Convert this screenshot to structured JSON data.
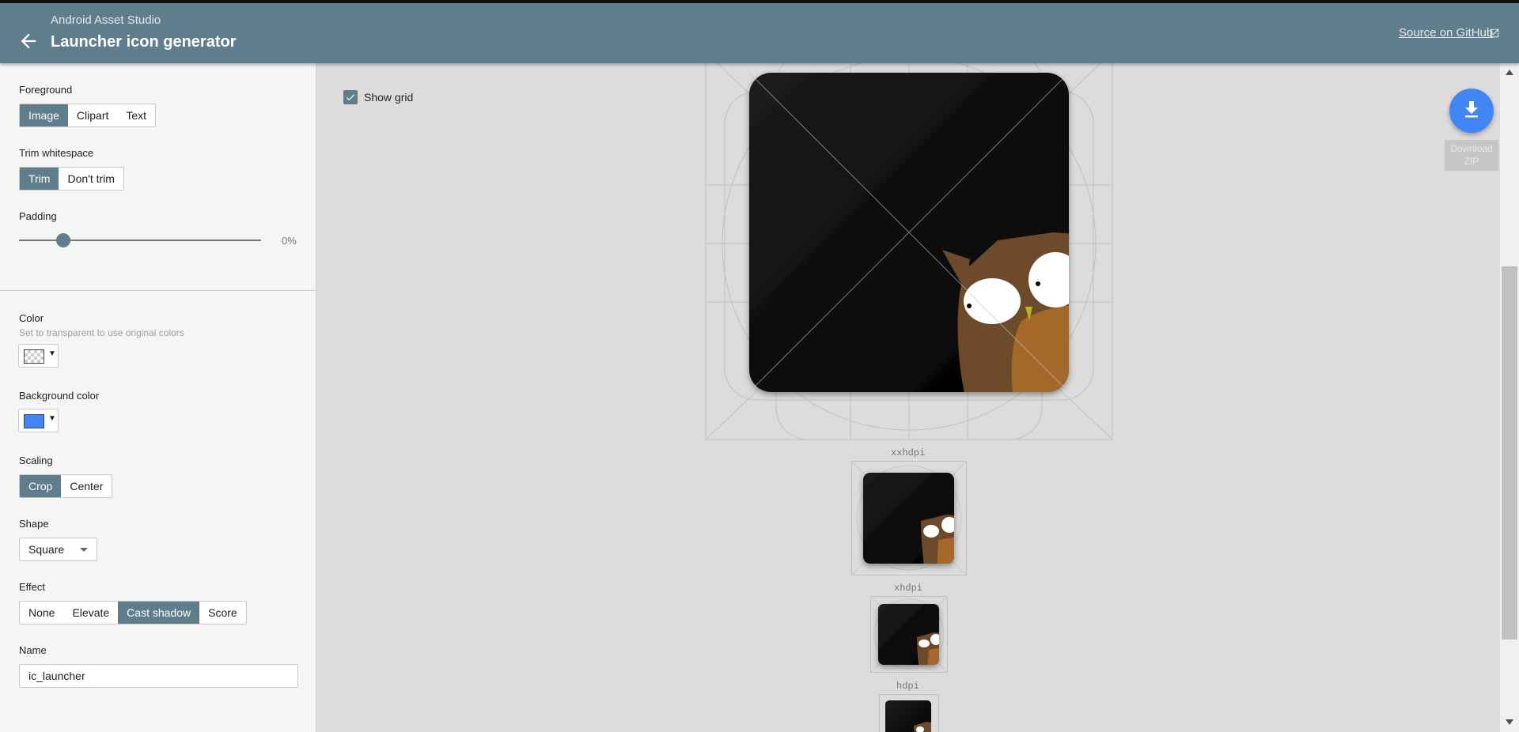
{
  "header": {
    "app_name": "Android Asset Studio",
    "title": "Launcher icon generator",
    "github_link": "Source on GitHub",
    "color": "#607d8b"
  },
  "sidebar": {
    "foreground": {
      "label": "Foreground",
      "options": [
        "Image",
        "Clipart",
        "Text"
      ],
      "selected": "Image"
    },
    "trim": {
      "label": "Trim whitespace",
      "options": [
        "Trim",
        "Don't trim"
      ],
      "selected": "Trim"
    },
    "padding": {
      "label": "Padding",
      "value": "0%",
      "fraction": 0.0
    },
    "color": {
      "label": "Color",
      "help": "Set to transparent to use original colors",
      "value": "transparent"
    },
    "background_color": {
      "label": "Background color",
      "value": "#4285f4"
    },
    "scaling": {
      "label": "Scaling",
      "options": [
        "Crop",
        "Center"
      ],
      "selected": "Crop"
    },
    "shape": {
      "label": "Shape",
      "value": "Square"
    },
    "effect": {
      "label": "Effect",
      "options": [
        "None",
        "Elevate",
        "Cast shadow",
        "Score"
      ],
      "selected": "Cast shadow"
    },
    "name": {
      "label": "Name",
      "value": "ic_launcher"
    }
  },
  "preview": {
    "show_grid_label": "Show grid",
    "show_grid_checked": true,
    "densities": [
      "xxhdpi",
      "xhdpi",
      "hdpi"
    ]
  },
  "download": {
    "label_line1": "Download",
    "label_line2": "ZIP"
  },
  "icons": {
    "back": "arrow-back-icon",
    "external": "open-in-new-icon",
    "download": "download-icon",
    "checkbox": "check-icon"
  }
}
